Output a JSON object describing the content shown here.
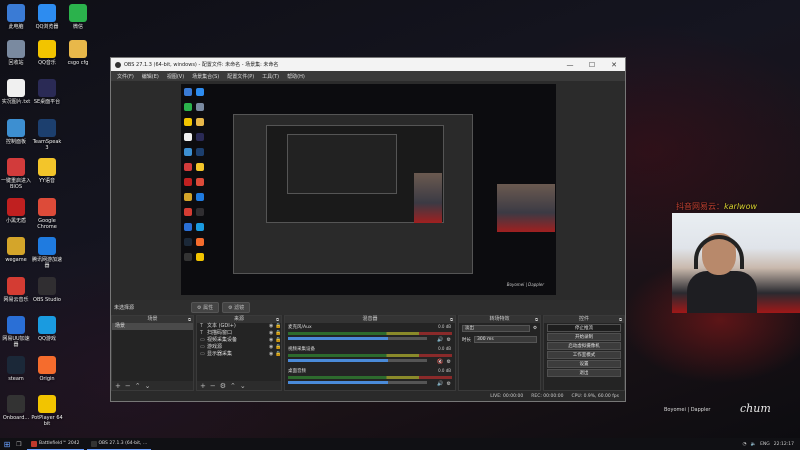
{
  "desktop": {
    "icons": [
      {
        "label": "此电脑",
        "icon": "computer-icon",
        "color": "#3a7bd5"
      },
      {
        "label": "QQ浏览器",
        "icon": "qq-browser-icon",
        "color": "#2d8cf0"
      },
      {
        "label": "微信",
        "icon": "wechat-icon",
        "color": "#2bb24c"
      },
      {
        "label": "回收站",
        "icon": "recycle-bin-icon",
        "color": "#7a8aa0"
      },
      {
        "label": "QQ音乐",
        "icon": "qq-music-icon",
        "color": "#f2c400"
      },
      {
        "label": "csgo cfg",
        "icon": "folder-icon",
        "color": "#e8b84a"
      },
      {
        "label": "实况图片.txt",
        "icon": "text-file-icon",
        "color": "#f0f0f0"
      },
      {
        "label": "SE桌面平台",
        "icon": "se-icon",
        "color": "#2a2a55"
      },
      {
        "label": "控制面板",
        "icon": "control-panel-icon",
        "color": "#3d8fd1"
      },
      {
        "label": "TeamSpeak 3",
        "icon": "teamspeak-icon",
        "color": "#1c3f6e"
      },
      {
        "label": "一键重启进入BIOS",
        "icon": "power-icon",
        "color": "#d23b3b"
      },
      {
        "label": "YY语音",
        "icon": "yy-icon",
        "color": "#f3c52a"
      },
      {
        "label": "小黑无盾",
        "icon": "shield-app-icon",
        "color": "#c02020"
      },
      {
        "label": "Google Chrome",
        "icon": "chrome-icon",
        "color": "#dd4b39"
      },
      {
        "label": "wegame",
        "icon": "wegame-icon",
        "color": "#d4a52a"
      },
      {
        "label": "腾讯网游加速器",
        "icon": "accelerator-icon",
        "color": "#1f7be0"
      },
      {
        "label": "网易云音乐",
        "icon": "netease-music-icon",
        "color": "#d43c33"
      },
      {
        "label": "OBS Studio",
        "icon": "obs-icon",
        "color": "#302e31"
      },
      {
        "label": "网易UU加速器",
        "icon": "uu-icon",
        "color": "#2a6fd6"
      },
      {
        "label": "QQ游戏",
        "icon": "qq-game-icon",
        "color": "#1a9be0"
      },
      {
        "label": "steam",
        "icon": "steam-icon",
        "color": "#1b2838"
      },
      {
        "label": "Origin",
        "icon": "origin-icon",
        "color": "#f56c2d"
      },
      {
        "label": "Onboard...",
        "icon": "onboard-icon",
        "color": "#333"
      },
      {
        "label": "PotPlayer 64 bit",
        "icon": "potplayer-icon",
        "color": "#f2c400"
      }
    ]
  },
  "obs": {
    "title": "OBS 27.1.3 (64-bit, windows) - 配置文件: 未命名 - 场景集: 未命名",
    "window_controls": {
      "minimize": "—",
      "maximize": "☐",
      "close": "✕"
    },
    "menu": [
      "文件(F)",
      "编辑(E)",
      "视图(V)",
      "场景集合(S)",
      "配置文件(P)",
      "工具(T)",
      "帮助(H)"
    ],
    "preview_signature": "Boyomei | Dappler",
    "source_bar": {
      "no_selection": "未选择源",
      "properties": "属性",
      "filters": "滤镜"
    },
    "scenes": {
      "header": "场景",
      "items": [
        "场景"
      ]
    },
    "sources": {
      "header": "来源",
      "items": [
        {
          "name": "文本 (GDI+)",
          "icon": "T"
        },
        {
          "name": "扫描码窗口",
          "icon": "T"
        },
        {
          "name": "视频采集设备",
          "icon": "▭"
        },
        {
          "name": "游戏源",
          "icon": "▭"
        },
        {
          "name": "显示器采集",
          "icon": "▭"
        }
      ]
    },
    "mixer": {
      "header": "混音器",
      "channels": [
        {
          "name": "麦克风/Aux",
          "db": "0.0 dB",
          "level": 0.72,
          "muted": false
        },
        {
          "name": "视频采集设备",
          "db": "0.0 dB",
          "level": 0.72,
          "muted": true
        },
        {
          "name": "桌面音频",
          "db": "0.0 dB",
          "level": 0.72,
          "muted": false
        }
      ]
    },
    "transitions": {
      "header": "转场特效",
      "type": "淡出",
      "duration_label": "时长",
      "duration": "300 ms"
    },
    "controls": {
      "header": "控件",
      "buttons": [
        "停止推流",
        "开始录制",
        "启动虚拟摄像机",
        "工作室模式",
        "设置",
        "退出"
      ]
    },
    "status": {
      "live": "LIVE: 00:00:00",
      "rec": "REC: 00:00:00",
      "cpu": "CPU: 0.9%, 60.00 fps"
    }
  },
  "overlay": {
    "watermark_prefix": "抖音网易云：",
    "watermark_name": "karlwow",
    "signature": "Boyomei | Dappler",
    "signature_script": "chum"
  },
  "taskbar": {
    "tasks": [
      {
        "label": "Battlefield™ 2042",
        "color": "#c0392b"
      },
      {
        "label": "OBS 27.1.3 (64-bit, ...",
        "color": "#333"
      }
    ],
    "lang": "ENG",
    "time": "22:12:17"
  }
}
